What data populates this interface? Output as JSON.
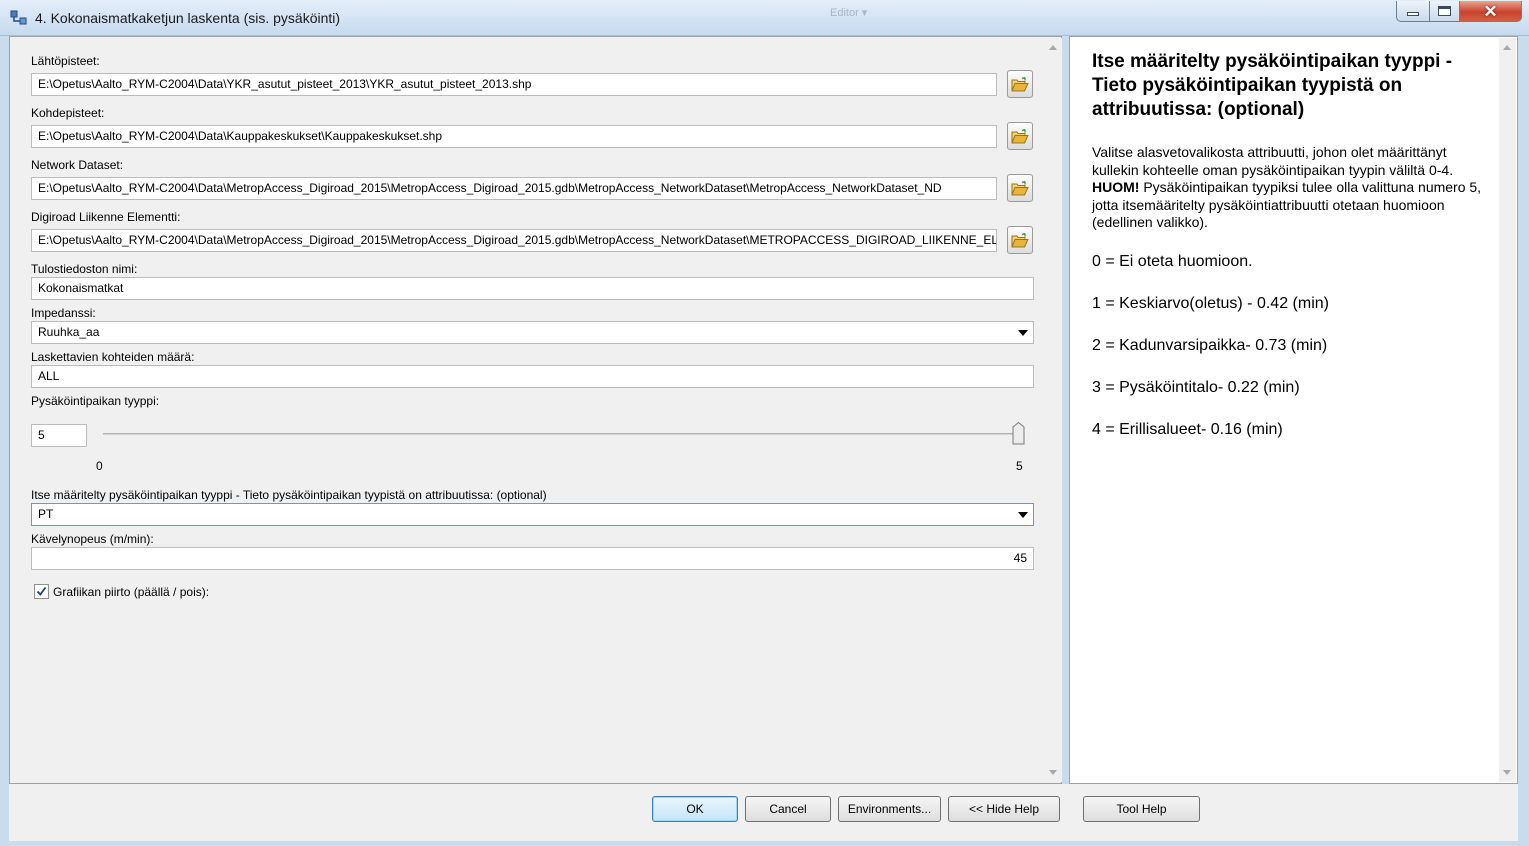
{
  "window": {
    "title": "4. Kokonaismatkaketjun laskenta (sis. pysäköinti)",
    "background_hint": "Editor ▾"
  },
  "form": {
    "origin": {
      "label": "Lähtöpisteet:",
      "value": "E:\\Opetus\\Aalto_RYM-C2004\\Data\\YKR_asutut_pisteet_2013\\YKR_asutut_pisteet_2013.shp"
    },
    "destination": {
      "label": "Kohdepisteet:",
      "value": "E:\\Opetus\\Aalto_RYM-C2004\\Data\\Kauppakeskukset\\Kauppakeskukset.shp"
    },
    "network": {
      "label": "Network Dataset:",
      "value": "E:\\Opetus\\Aalto_RYM-C2004\\Data\\MetropAccess_Digiroad_2015\\MetropAccess_Digiroad_2015.gdb\\MetropAccess_NetworkDataset\\MetropAccess_NetworkDataset_ND"
    },
    "digiroad": {
      "label": "Digiroad Liikenne Elementti:",
      "value": "E:\\Opetus\\Aalto_RYM-C2004\\Data\\MetropAccess_Digiroad_2015\\MetropAccess_Digiroad_2015.gdb\\MetropAccess_NetworkDataset\\METROPACCESS_DIGIROAD_LIIKENNE_ELEMENTTI"
    },
    "output_name": {
      "label": "Tulostiedoston nimi:",
      "value": "Kokonaismatkat"
    },
    "impedance": {
      "label": "Impedanssi:",
      "value": "Ruuhka_aa"
    },
    "target_count": {
      "label": "Laskettavien kohteiden määrä:",
      "value": "ALL"
    },
    "parking_type": {
      "label": "Pysäköintipaikan tyyppi:",
      "value": "5",
      "min_label": "0",
      "max_label": "5",
      "min": 0,
      "max": 5,
      "current": 5
    },
    "custom_parking": {
      "label": "Itse määritelty pysäköintipaikan tyyppi - Tieto pysäköintipaikan tyypistä on attribuutissa: (optional)",
      "value": "PT"
    },
    "walking_speed": {
      "label": "Kävelynopeus (m/min):",
      "value": "45"
    },
    "graphics": {
      "label": "Grafiikan piirto (päällä / pois):",
      "checked": true
    }
  },
  "buttons": {
    "ok": "OK",
    "cancel": "Cancel",
    "environments": "Environments...",
    "hide_help": "<< Hide Help",
    "tool_help": "Tool Help"
  },
  "help": {
    "title": "Itse määritelty pysäköintipaikan tyyppi - Tieto pysäköintipaikan tyypistä on attribuutissa: (optional)",
    "p1": "Valitse alasvetovalikosta attribuutti, johon olet määrittänyt kullekin kohteelle oman pysäköintipaikan tyypin väliltä 0-4.",
    "p1_bold": "HUOM!",
    "p1_rest": "Pysäköintipaikan tyypiksi tulee olla valittuna numero 5, jotta itsemääritelty pysäköintiattribuutti otetaan huomioon (edellinen valikko).",
    "options": [
      "0 = Ei oteta huomioon.",
      "1 = Keskiarvo(oletus) - 0.42 (min)",
      "2 = Kadunvarsipaikka- 0.73 (min)",
      "3 = Pysäköintitalo- 0.22 (min)",
      "4 = Erillisalueet- 0.16 (min)"
    ]
  },
  "icons": {
    "app": "arcgis-model-icon",
    "browse": "folder-open-icon",
    "checkbox": "checkmark-icon"
  },
  "colors": {
    "panel_bg": "#f0f0f0",
    "frame": "#c9dcee",
    "folder": "#e8b53a",
    "default_button": "#3c7fb1"
  }
}
